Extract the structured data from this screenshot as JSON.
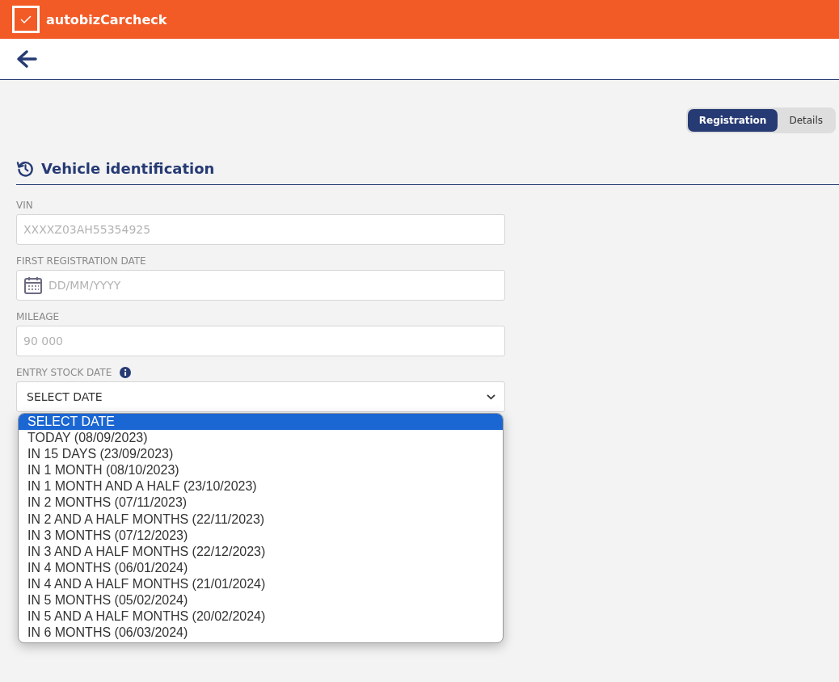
{
  "app": {
    "title": "autobizCarcheck"
  },
  "tabs": [
    {
      "label": "Registration",
      "selected": true
    },
    {
      "label": "Details",
      "selected": false
    }
  ],
  "section": {
    "title": "Vehicle identification"
  },
  "fields": [
    {
      "kind": "text",
      "label": "VIN",
      "placeholder": "XXXXZ03AH55354925"
    },
    {
      "kind": "date",
      "label": "FIRST REGISTRATION DATE",
      "placeholder": "DD/MM/YYYY"
    },
    {
      "kind": "text",
      "label": "MILEAGE",
      "placeholder": "90 000"
    }
  ],
  "select": {
    "label": "ENTRY STOCK DATE",
    "info": true,
    "value": "SELECT DATE",
    "expanded": true,
    "options": [
      {
        "label": "SELECT DATE",
        "selected": true
      },
      {
        "label": "TODAY (08/09/2023)",
        "selected": false
      },
      {
        "label": "IN 15 DAYS (23/09/2023)",
        "selected": false
      },
      {
        "label": "IN 1 MONTH (08/10/2023)",
        "selected": false
      },
      {
        "label": "IN 1 MONTH AND A HALF (23/10/2023)",
        "selected": false
      },
      {
        "label": "IN 2 MONTHS (07/11/2023)",
        "selected": false
      },
      {
        "label": "IN 2 AND A HALF MONTHS (22/11/2023)",
        "selected": false
      },
      {
        "label": "IN 3 MONTHS (07/12/2023)",
        "selected": false
      },
      {
        "label": "IN 3 AND A HALF MONTHS (22/12/2023)",
        "selected": false
      },
      {
        "label": "IN 4 MONTHS (06/01/2024)",
        "selected": false
      },
      {
        "label": "IN 4 AND A HALF MONTHS (21/01/2024)",
        "selected": false
      },
      {
        "label": "IN 5 MONTHS (05/02/2024)",
        "selected": false
      },
      {
        "label": "IN 5 AND A HALF MONTHS (20/02/2024)",
        "selected": false
      },
      {
        "label": "IN 6 MONTHS (06/03/2024)",
        "selected": false
      }
    ]
  }
}
